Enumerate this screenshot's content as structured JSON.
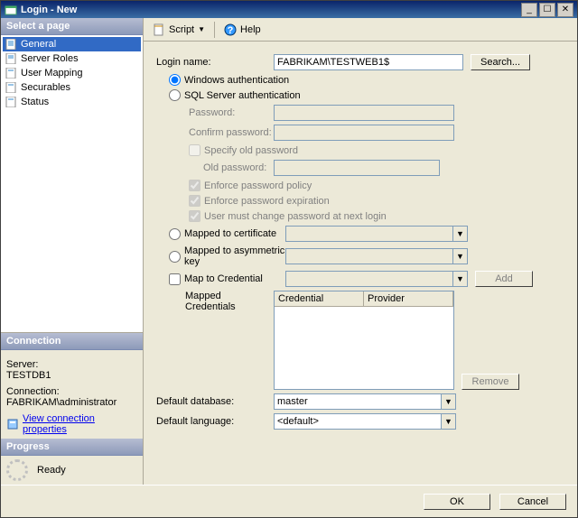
{
  "window": {
    "title": "Login - New"
  },
  "toolbar": {
    "script": "Script",
    "help": "Help"
  },
  "pageSelector": {
    "header": "Select a page",
    "items": [
      "General",
      "Server Roles",
      "User Mapping",
      "Securables",
      "Status"
    ],
    "selectedIndex": 0
  },
  "connection": {
    "header": "Connection",
    "serverLabel": "Server:",
    "serverValue": "TESTDB1",
    "connLabel": "Connection:",
    "connValue": "FABRIKAM\\administrator",
    "viewProps": "View connection properties"
  },
  "progress": {
    "header": "Progress",
    "status": "Ready"
  },
  "form": {
    "loginNameLabel": "Login name:",
    "loginNameValue": "FABRIKAM\\TESTWEB1$",
    "searchBtn": "Search...",
    "authWindows": "Windows authentication",
    "authSql": "SQL Server authentication",
    "passwordLabel": "Password:",
    "confirmLabel": "Confirm password:",
    "specifyOld": "Specify old password",
    "oldPasswordLabel": "Old password:",
    "enforcePolicy": "Enforce password policy",
    "enforceExpire": "Enforce password expiration",
    "mustChange": "User must change password at next login",
    "mappedCert": "Mapped to certificate",
    "mappedAsym": "Mapped to asymmetric key",
    "mapCred": "Map to Credential",
    "addBtn": "Add",
    "mappedCredsLabel": "Mapped Credentials",
    "credCol": "Credential",
    "provCol": "Provider",
    "removeBtn": "Remove",
    "defDbLabel": "Default database:",
    "defDbValue": "master",
    "defLangLabel": "Default language:",
    "defLangValue": "<default>"
  },
  "footer": {
    "ok": "OK",
    "cancel": "Cancel"
  }
}
